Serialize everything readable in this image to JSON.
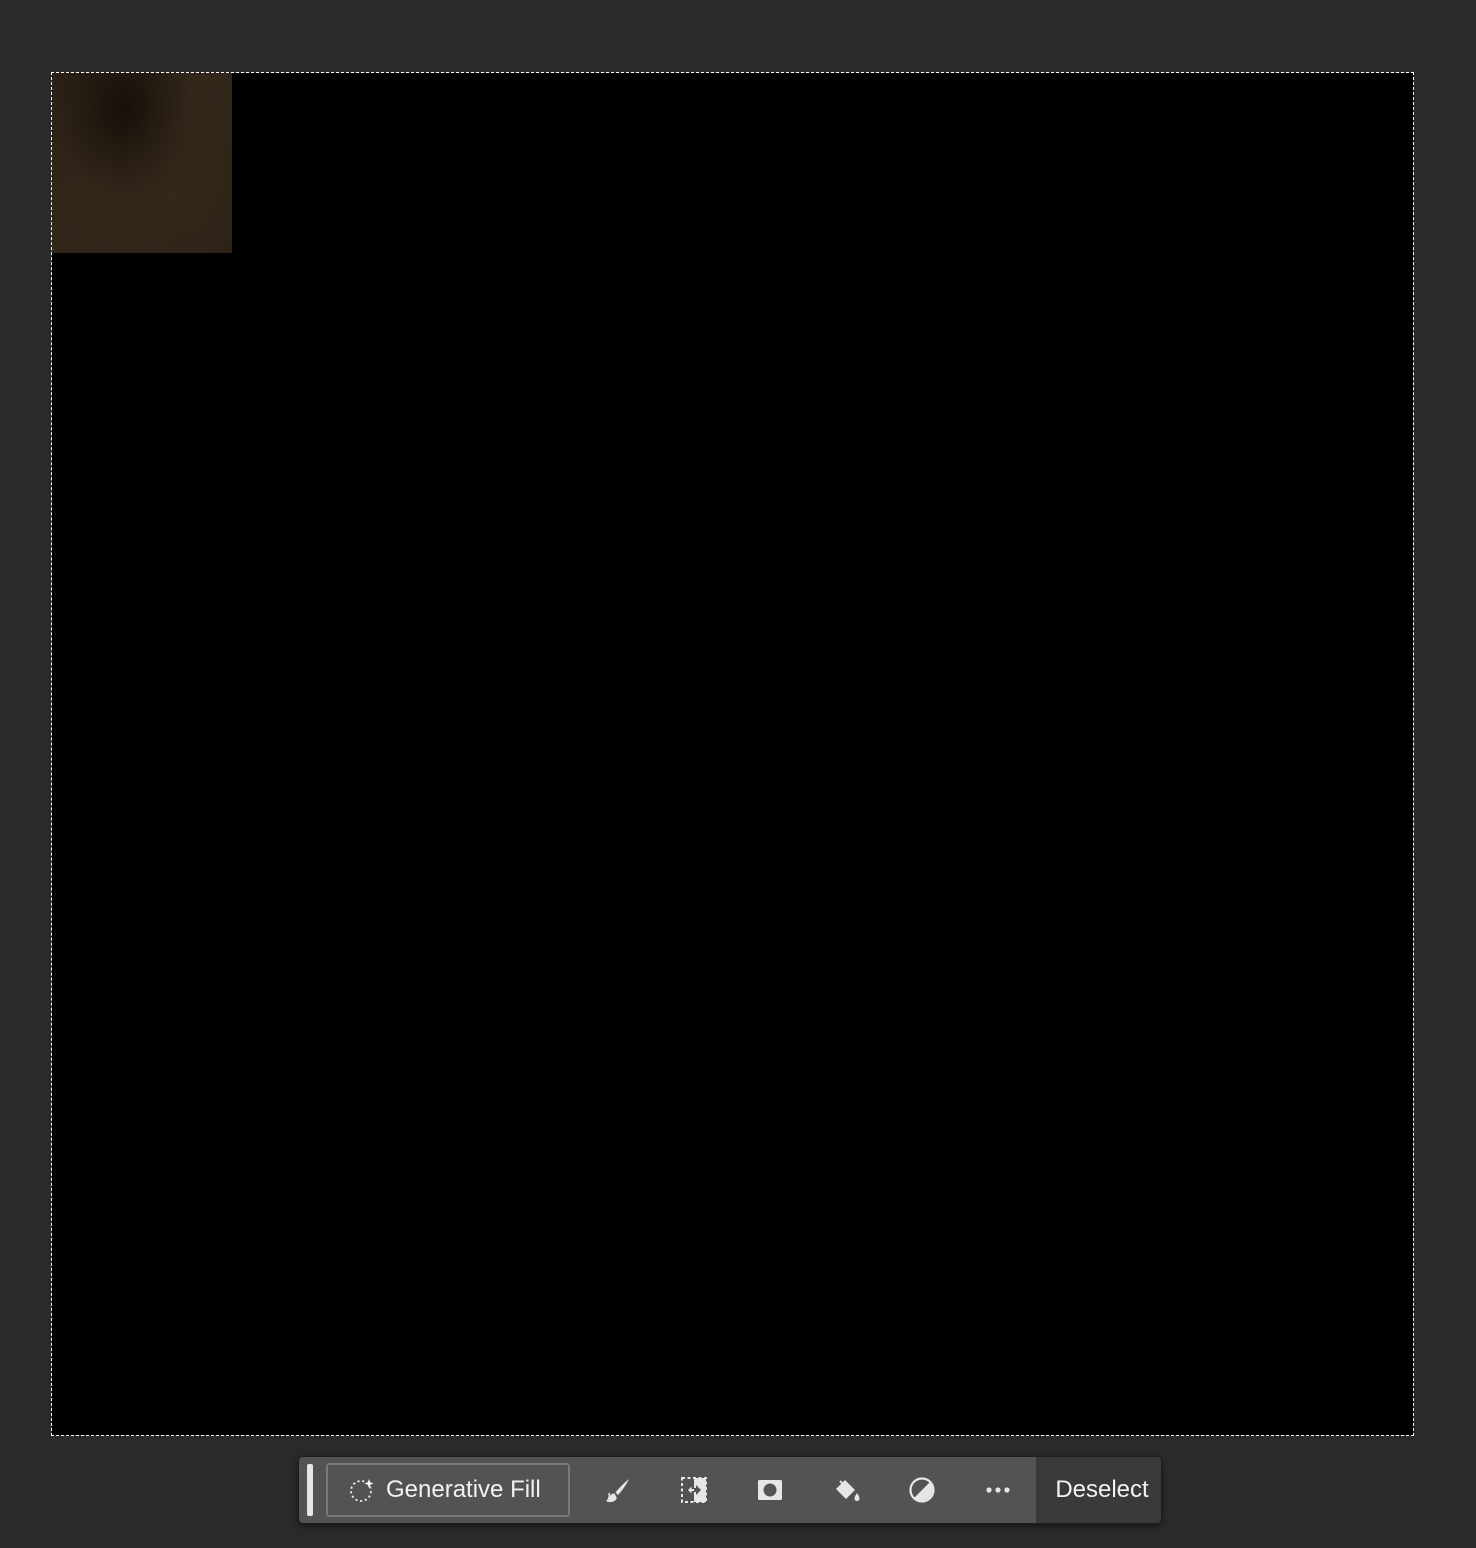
{
  "taskbar": {
    "generative_fill_label": "Generative Fill",
    "tools": [
      {
        "name": "brush-icon"
      },
      {
        "name": "transform-selection-icon"
      },
      {
        "name": "mask-icon"
      },
      {
        "name": "fill-bucket-icon"
      },
      {
        "name": "adjustment-icon"
      },
      {
        "name": "more-icon"
      }
    ],
    "deselect_label": "Deselect"
  },
  "colors": {
    "workspace_background": "#2a2a2a",
    "canvas_background": "#000000",
    "taskbar_background": "#535353",
    "taskbar_accent": "#3a3a3a",
    "text": "#f2f2f2",
    "selection_marquee": "#ffffff"
  }
}
